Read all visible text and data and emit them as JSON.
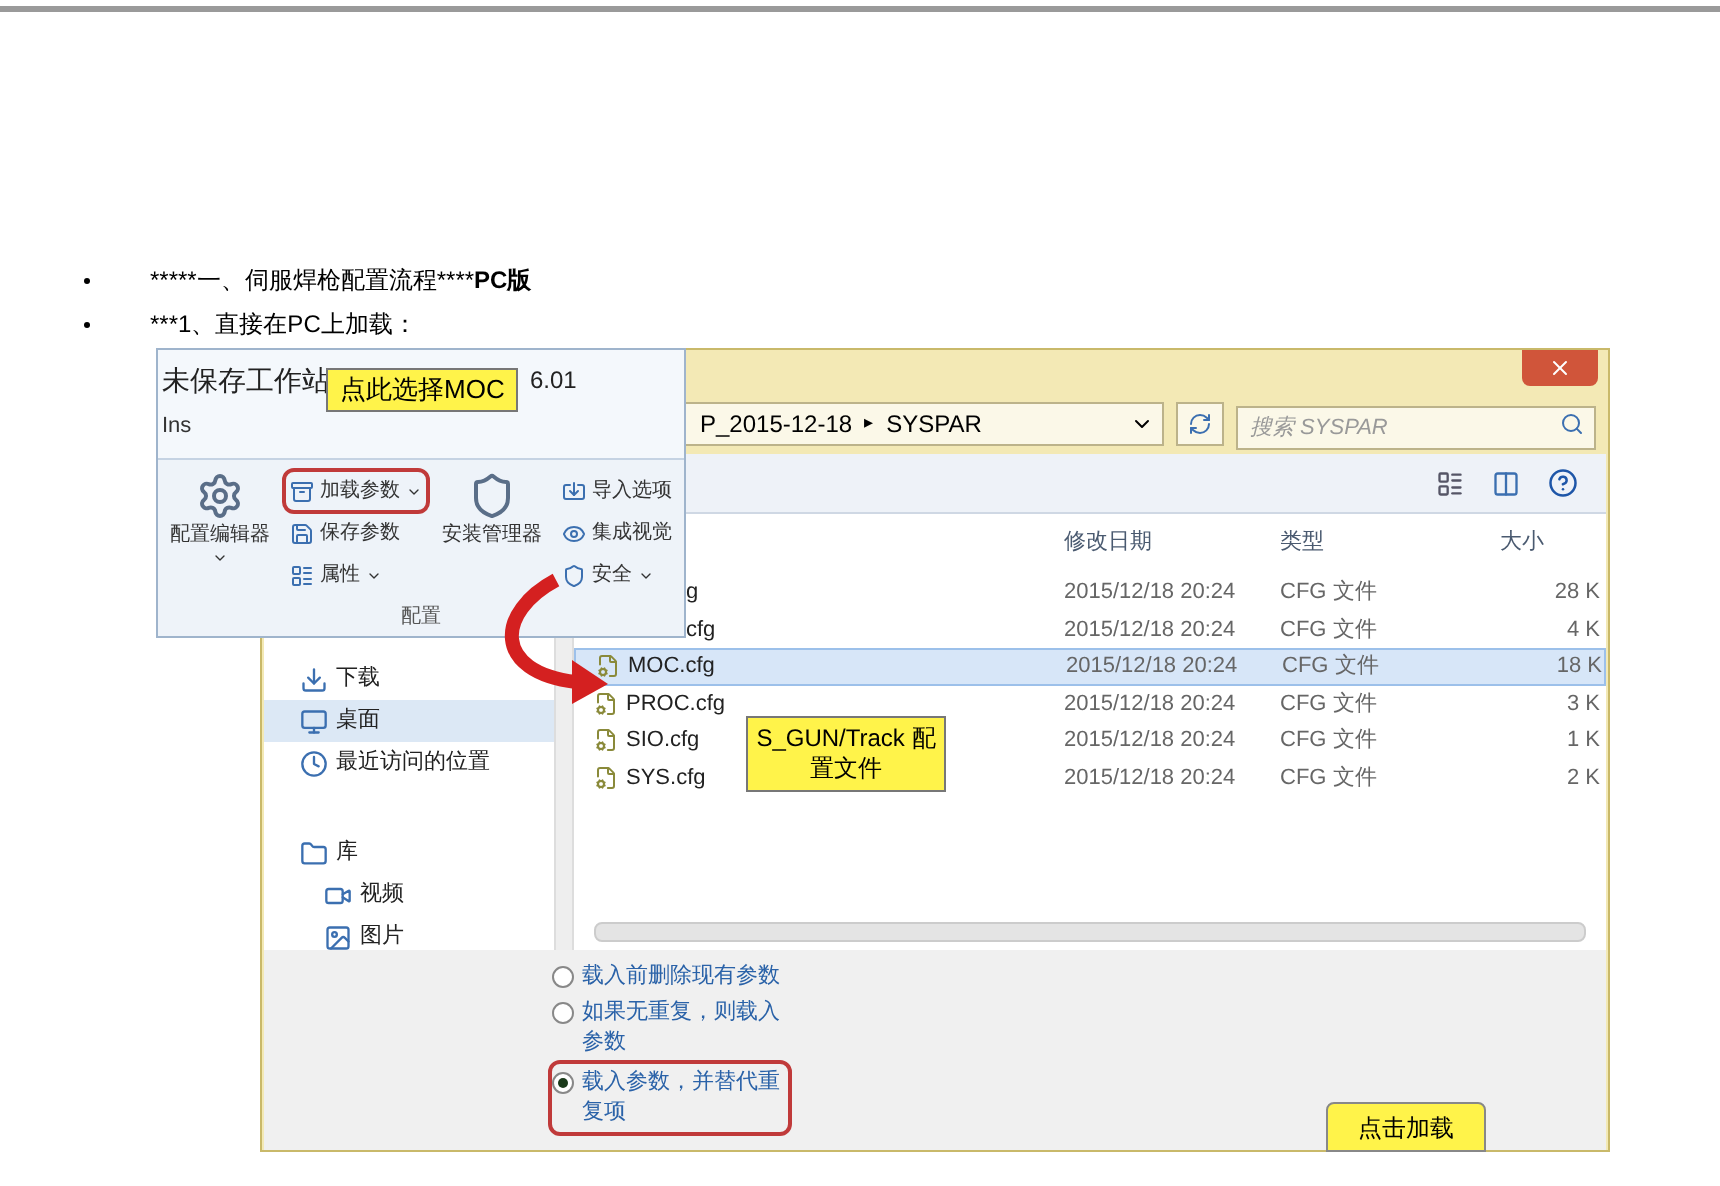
{
  "document": {
    "bullets": [
      {
        "text": "*****一、伺服焊枪配置流程****",
        "bold_text": "PC版"
      },
      {
        "text": "***1、直接在PC上加载："
      }
    ]
  },
  "explorer": {
    "address": {
      "path": "P_2015-12-18",
      "folder": "SYSPAR",
      "separator": "▸"
    },
    "search": {
      "placeholder": "搜索 SYSPAR"
    },
    "nav": [
      {
        "label": "下载",
        "selected": false
      },
      {
        "label": "桌面",
        "selected": true
      },
      {
        "label": "最近访问的位置",
        "selected": false
      },
      {
        "label": "库",
        "selected": false,
        "children": [
          {
            "label": "视频",
            "selected": false
          },
          {
            "label": "图片",
            "selected": false
          }
        ]
      }
    ],
    "columns": [
      "修改日期",
      "类型",
      "大小"
    ],
    "files": [
      {
        "kind": "cut",
        "name": "g",
        "date": "2015/12/18 20:24",
        "type": "CFG 文件",
        "size": "28 K",
        "selected": false
      },
      {
        "kind": "cut",
        "name": "cfg",
        "date": "2015/12/18 20:24",
        "type": "CFG 文件",
        "size": "4 K",
        "selected": false
      },
      {
        "kind": "full",
        "name": "MOC.cfg",
        "date": "2015/12/18 20:24",
        "type": "CFG 文件",
        "size": "18 K",
        "selected": true
      },
      {
        "kind": "full",
        "name": "PROC.cfg",
        "date": "2015/12/18 20:24",
        "type": "CFG 文件",
        "size": "3 K",
        "selected": false
      },
      {
        "kind": "full",
        "name": "SIO.cfg",
        "date": "2015/12/18 20:24",
        "type": "CFG 文件",
        "size": "1 K",
        "selected": false
      },
      {
        "kind": "full",
        "name": "SYS.cfg",
        "date": "2015/12/18 20:24",
        "type": "CFG 文件",
        "size": "2 K",
        "selected": false
      }
    ],
    "load_options": [
      {
        "label": "载入前删除现有参数",
        "selected": false
      },
      {
        "label": "如果无重复，则载入参数",
        "selected": false
      },
      {
        "label": "载入参数，并替代重复项",
        "selected": true
      }
    ]
  },
  "ribbon_popup": {
    "title": "未保存工作站",
    "version": "6.01",
    "tab": "Ins",
    "group_label": "配置",
    "buttons": [
      {
        "label": "配置编辑器",
        "kind": "large",
        "dropdown": true
      },
      {
        "label": "加载参数",
        "kind": "small",
        "dropdown": true
      },
      {
        "label": "保存参数",
        "kind": "small",
        "dropdown": false
      },
      {
        "label": "属性",
        "kind": "small",
        "dropdown": true
      },
      {
        "label": "安装管理器",
        "kind": "large",
        "dropdown": false
      },
      {
        "label": "导入选项",
        "kind": "small",
        "dropdown": false
      },
      {
        "label": "集成视觉",
        "kind": "small",
        "dropdown": false
      },
      {
        "label": "安全",
        "kind": "small",
        "dropdown": true
      }
    ]
  },
  "callouts": [
    {
      "text": "点此选择MOC"
    },
    {
      "text": "S_GUN/Track 配置文件"
    },
    {
      "text": "点击加载"
    }
  ]
}
